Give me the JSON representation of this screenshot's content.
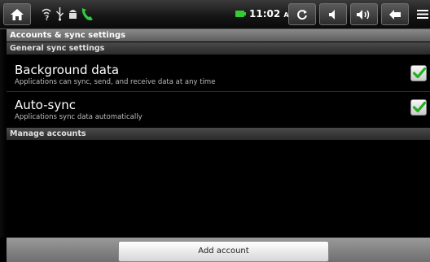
{
  "status_bar": {
    "time": "11:02",
    "ampm": "AM",
    "icons": [
      "home-icon",
      "wifi-question-icon",
      "usb-icon",
      "android-debug-icon",
      "phone-icon",
      "battery-icon",
      "refresh-icon",
      "volume-down-icon",
      "volume-up-icon",
      "back-icon",
      "menu-icon"
    ],
    "colors": {
      "battery": "#33cc33",
      "phone": "#2ecc40"
    }
  },
  "title": "Accounts & sync settings",
  "sections": {
    "general": "General sync settings",
    "manage": "Manage accounts"
  },
  "settings": [
    {
      "title": "Background data",
      "subtitle": "Applications can sync, send, and receive data at any time",
      "checked": true
    },
    {
      "title": "Auto-sync",
      "subtitle": "Applications sync data automatically",
      "checked": true
    }
  ],
  "add_account_label": "Add account"
}
